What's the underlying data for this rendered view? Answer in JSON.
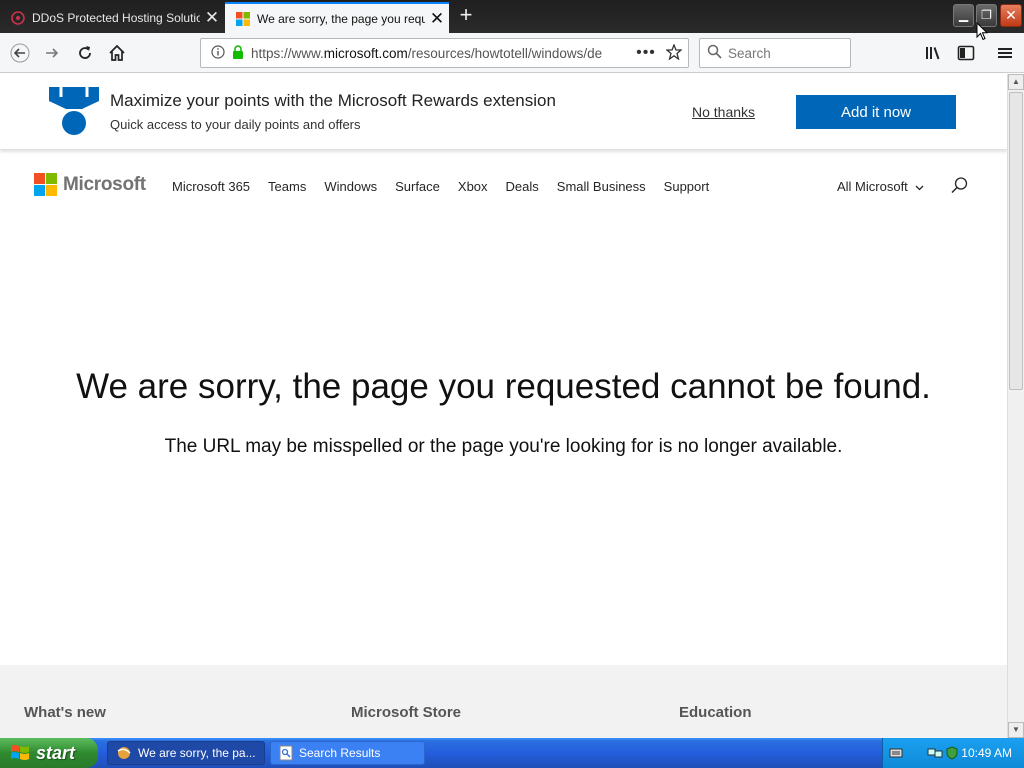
{
  "browser": {
    "tabs": [
      {
        "title": "DDoS Protected Hosting Solutions",
        "favicon": "hosting-favicon"
      },
      {
        "title": "We are sorry, the page you reque",
        "favicon": "microsoft-favicon"
      }
    ],
    "url": {
      "prefix": "https://www.",
      "host": "microsoft.com",
      "path": "/resources/howtotell/windows/de"
    },
    "search_placeholder": "Search"
  },
  "banner": {
    "title": "Maximize your points with the Microsoft Rewards extension",
    "subtitle": "Quick access to your daily points and offers",
    "dismiss": "No thanks",
    "cta": "Add it now"
  },
  "header": {
    "brand": "Microsoft",
    "nav": [
      "Microsoft 365",
      "Teams",
      "Windows",
      "Surface",
      "Xbox",
      "Deals",
      "Small Business",
      "Support"
    ],
    "all_microsoft": "All Microsoft"
  },
  "main": {
    "title": "We are sorry, the page you requested cannot be found.",
    "subtitle": "The URL may be misspelled or the page you're looking for is no longer available."
  },
  "footer": {
    "headings": [
      "What's new",
      "Microsoft Store",
      "Education"
    ]
  },
  "taskbar": {
    "start": "start",
    "items": [
      {
        "label": "We are sorry, the pa...",
        "active": true
      },
      {
        "label": "Search Results",
        "active": false
      }
    ],
    "clock": "10:49 AM"
  },
  "colors": {
    "accent": "#0067b8",
    "ms_red": "#f25022",
    "ms_green": "#7fba00",
    "ms_blue": "#00a4ef",
    "ms_yellow": "#ffb900"
  }
}
